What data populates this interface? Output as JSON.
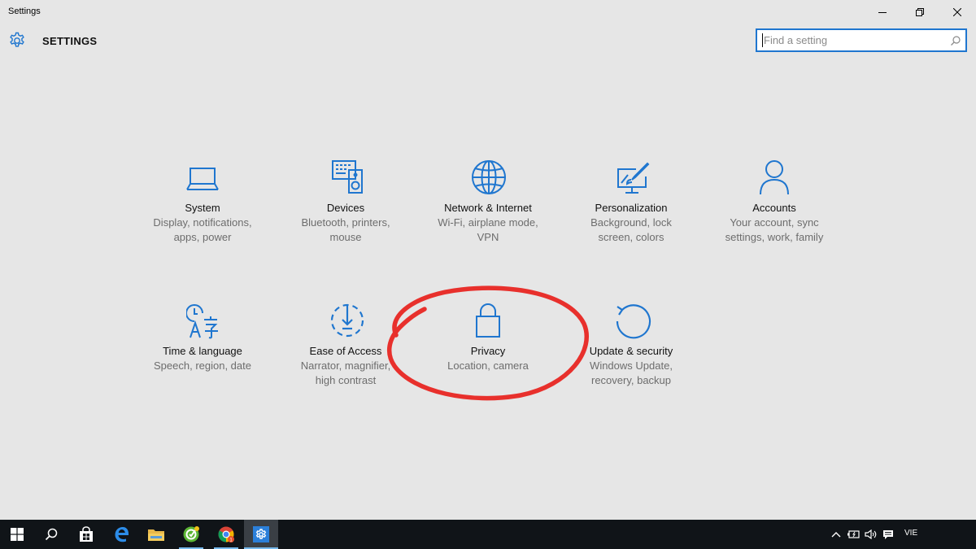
{
  "window": {
    "title": "Settings",
    "controls": [
      "minimize-icon",
      "restore-icon",
      "close-icon"
    ]
  },
  "header": {
    "icon": "gear-icon",
    "title": "SETTINGS"
  },
  "search": {
    "placeholder": "Find a setting",
    "value": "",
    "icon": "search-icon"
  },
  "categories": [
    {
      "icon": "laptop-icon",
      "title": "System",
      "desc1": "Display, notifications,",
      "desc2": "apps, power"
    },
    {
      "icon": "devices-icon",
      "title": "Devices",
      "desc1": "Bluetooth, printers,",
      "desc2": "mouse"
    },
    {
      "icon": "globe-icon",
      "title": "Network & Internet",
      "desc1": "Wi-Fi, airplane mode,",
      "desc2": "VPN"
    },
    {
      "icon": "personalization-icon",
      "title": "Personalization",
      "desc1": "Background, lock",
      "desc2": "screen, colors"
    },
    {
      "icon": "person-icon",
      "title": "Accounts",
      "desc1": "Your account, sync",
      "desc2": "settings, work, family"
    },
    {
      "icon": "time-language-icon",
      "title": "Time & language",
      "desc1": "Speech, region, date",
      "desc2": ""
    },
    {
      "icon": "ease-of-access-icon",
      "title": "Ease of Access",
      "desc1": "Narrator, magnifier,",
      "desc2": "high contrast"
    },
    {
      "icon": "lock-icon",
      "title": "Privacy",
      "desc1": "Location, camera",
      "desc2": ""
    },
    {
      "icon": "update-icon",
      "title": "Update & security",
      "desc1": "Windows Update,",
      "desc2": "recovery, backup"
    }
  ],
  "annotation": {
    "shape": "ellipse",
    "color": "#e8302c",
    "highlights": "Privacy"
  },
  "taskbar": {
    "apps": [
      {
        "icon": "start-windows-icon"
      },
      {
        "icon": "search-icon"
      },
      {
        "icon": "store-icon"
      },
      {
        "icon": "edge-icon"
      },
      {
        "icon": "file-explorer-icon"
      },
      {
        "icon": "green-app-icon"
      },
      {
        "icon": "chrome-icon",
        "badge": "1"
      },
      {
        "icon": "settings-gear-icon",
        "active": true
      }
    ],
    "tray": {
      "icons": [
        "chevron-up-icon",
        "battery-icon",
        "volume-icon",
        "action-center-icon"
      ],
      "language": "VIE"
    }
  },
  "colors": {
    "background": "#e6e6e6",
    "accent": "#1f76cf",
    "taskbar": "#101418",
    "annotation": "#e8302c"
  }
}
